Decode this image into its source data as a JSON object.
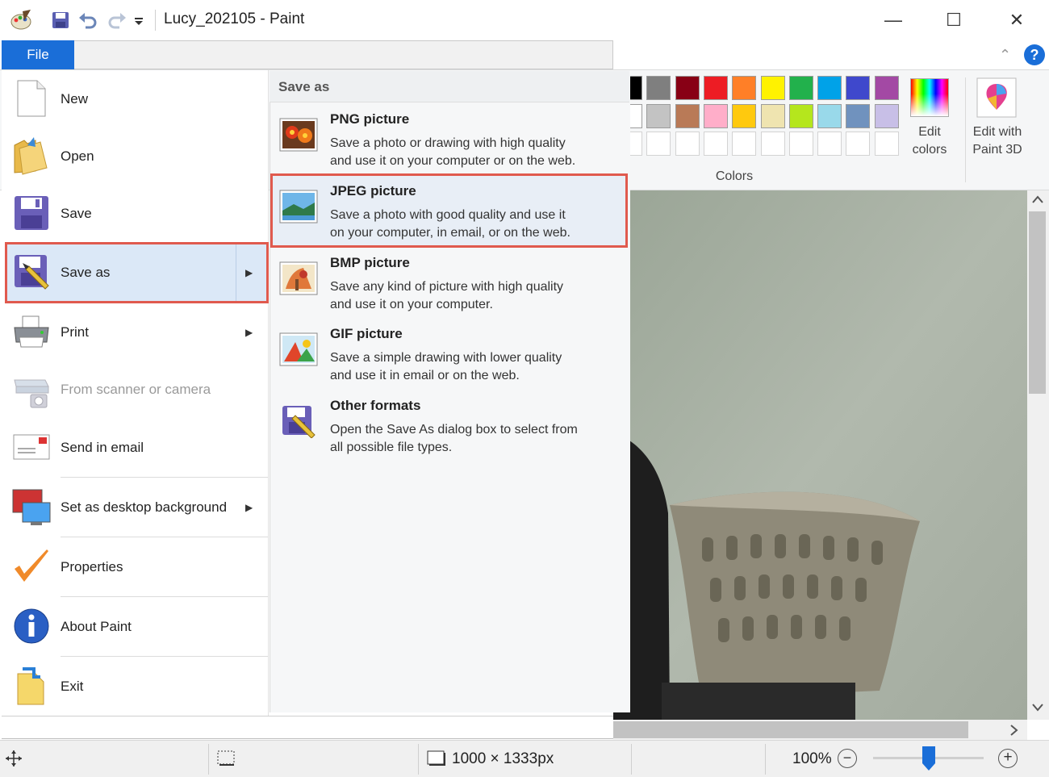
{
  "window": {
    "title": "Lucy_202105 - Paint",
    "minimize_glyph": "—",
    "maximize_glyph": "☐",
    "close_glyph": "✕"
  },
  "quick_access": {
    "icons": [
      "paint-app-icon",
      "save-icon",
      "undo-icon",
      "redo-icon",
      "customize-dropdown-icon"
    ]
  },
  "ribbon": {
    "file_tab": "File",
    "help_glyph": "?",
    "collapse_glyph": "⌃",
    "colors_label": "Colors",
    "edit_colors_line1": "Edit",
    "edit_colors_line2": "colors",
    "edit_paint3d_line1": "Edit with",
    "edit_paint3d_line2": "Paint 3D",
    "palette_row1": [
      "#000000",
      "#7f7f7f",
      "#880015",
      "#ed1c24",
      "#ff7f27",
      "#fff200",
      "#22b14c",
      "#00a2e8",
      "#3f48cc",
      "#a349a4"
    ],
    "palette_row2": [
      "#ffffff",
      "#c3c3c3",
      "#b97a57",
      "#ffaec9",
      "#ffc90e",
      "#efe4b0",
      "#b5e61d",
      "#99d9ea",
      "#7092be",
      "#c8bfe7"
    ]
  },
  "file_menu": {
    "items": [
      {
        "id": "new",
        "label": "New",
        "icon": "new-document-icon"
      },
      {
        "id": "open",
        "label": "Open",
        "icon": "open-folder-icon"
      },
      {
        "id": "save",
        "label": "Save",
        "icon": "save-disk-icon"
      },
      {
        "id": "save-as",
        "label": "Save as",
        "icon": "save-as-icon",
        "has_submenu": true,
        "selected": true
      },
      {
        "id": "print",
        "label": "Print",
        "icon": "printer-icon",
        "has_submenu": true
      },
      {
        "id": "scanner",
        "label": "From scanner or camera",
        "icon": "scanner-icon",
        "disabled": true
      },
      {
        "id": "send-email",
        "label": "Send in email",
        "icon": "email-icon"
      },
      {
        "id": "desktop-bg",
        "label": "Set as desktop background",
        "icon": "desktop-icon",
        "has_submenu": true
      },
      {
        "id": "properties",
        "label": "Properties",
        "icon": "checkmark-icon"
      },
      {
        "id": "about",
        "label": "About Paint",
        "icon": "info-icon"
      },
      {
        "id": "exit",
        "label": "Exit",
        "icon": "exit-icon"
      }
    ]
  },
  "save_as_menu": {
    "title": "Save as",
    "items": [
      {
        "id": "png",
        "title": "PNG picture",
        "desc1": "Save a photo or drawing with high quality",
        "desc2": "and use it on your computer or on the web.",
        "icon": "png-picture-icon"
      },
      {
        "id": "jpeg",
        "title": "JPEG picture",
        "desc1": "Save a photo with good quality and use it",
        "desc2": "on your computer, in email, or on the web.",
        "icon": "jpeg-picture-icon",
        "highlighted": true
      },
      {
        "id": "bmp",
        "title": "BMP picture",
        "desc1": "Save any kind of picture with high quality",
        "desc2": "and use it on your computer.",
        "icon": "bmp-picture-icon"
      },
      {
        "id": "gif",
        "title": "GIF picture",
        "desc1": "Save a simple drawing with lower quality",
        "desc2": "and use it in email or on the web.",
        "icon": "gif-picture-icon"
      },
      {
        "id": "other",
        "title": "Other formats",
        "desc1": "Open the Save As dialog box to select from",
        "desc2": "all possible file types.",
        "icon": "other-formats-icon"
      }
    ]
  },
  "status_bar": {
    "dimensions": "1000 × 1333px",
    "zoom": "100%",
    "zoom_level": 0.5,
    "zoom_minus": "−",
    "zoom_plus": "+"
  },
  "colors": {
    "accent": "#1a6ed8",
    "highlight_border": "#e05a4e",
    "canvas_wall": "#a9b2a6"
  }
}
